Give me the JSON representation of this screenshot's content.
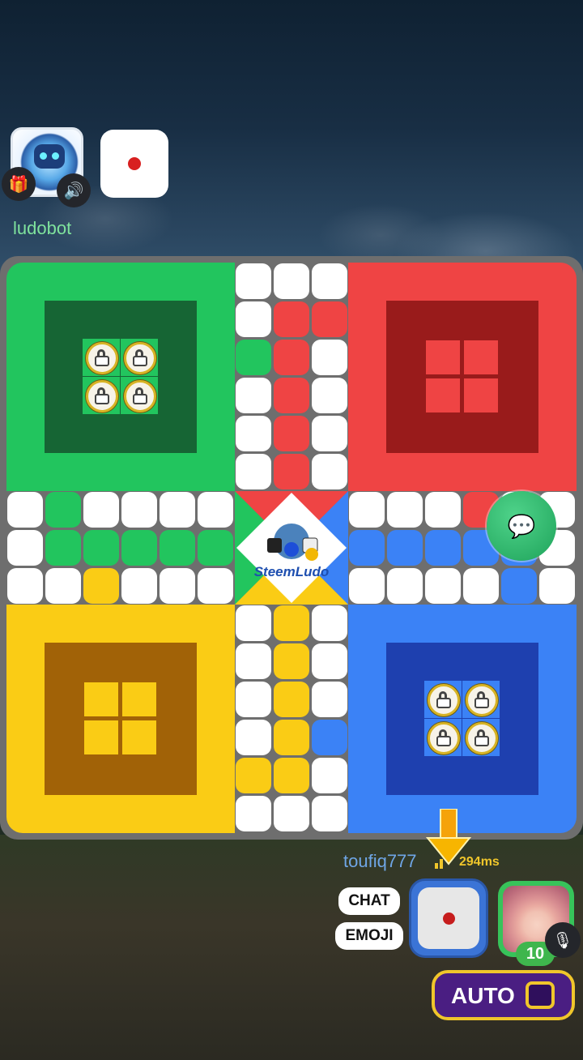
{
  "top_player": {
    "name": "ludobot",
    "gift_icon": "gift-icon",
    "sound_icon": "speaker-icon"
  },
  "board": {
    "logo_text": "SteemLudo",
    "colors": {
      "green": "#22c55e",
      "green_dark": "#166534",
      "red": "#ef4444",
      "red_dark": "#991b1b",
      "yellow": "#facc15",
      "yellow_dark": "#a16207",
      "blue": "#3b82f6",
      "blue_dark": "#1e40af"
    }
  },
  "bottom_player": {
    "name": "toufiq777",
    "ping": "294ms",
    "level": "10",
    "chat_label": "CHAT",
    "emoji_label": "EMOJI",
    "auto_label": "AUTO"
  }
}
